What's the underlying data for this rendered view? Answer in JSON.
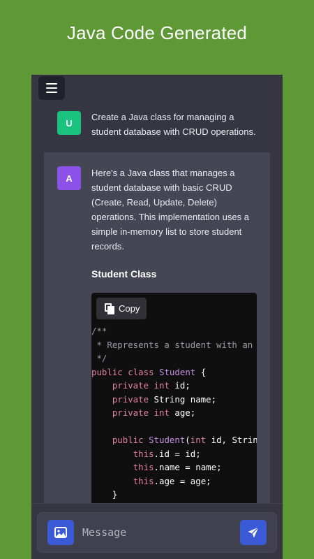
{
  "headline": "Java Code Generated",
  "chat": {
    "user": {
      "avatar": "U",
      "text": "Create a Java class for managing a student database with CRUD operations."
    },
    "assistant": {
      "avatar": "A",
      "text": "Here's a Java class that manages a student database with basic CRUD (Create, Read, Update, Delete) operations. This implementation uses a simple in-memory list to store student records.",
      "section_title": "Student Class",
      "copy_label": "Copy",
      "code_lines": [
        "/**",
        " * Represents a student with an ID, name, and age.",
        " */",
        "public class Student {",
        "    private int id;",
        "    private String name;",
        "    private int age;",
        "",
        "    public Student(int id, String name, int age) {",
        "        this.id = id;",
        "        this.name = name;",
        "        this.age = age;",
        "    }"
      ]
    }
  },
  "composer": {
    "placeholder": "Message"
  },
  "colors": {
    "background": "#5f9935",
    "app_bg": "#353641",
    "assistant_bg": "#444654",
    "user_avatar": "#19c37d",
    "assistant_avatar": "#8c52e8",
    "accent": "#3b5bd6",
    "code_bg": "#0f0f10"
  },
  "icons": {
    "menu": "hamburger-menu-icon",
    "copy": "copy-icon",
    "image": "image-icon",
    "send": "send-icon"
  }
}
